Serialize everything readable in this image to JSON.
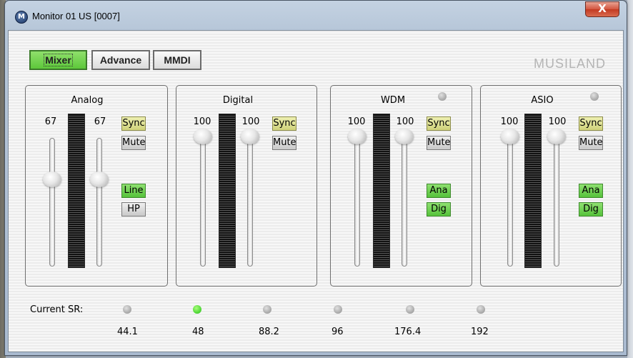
{
  "window": {
    "title": "Monitor 01 US [0007]",
    "icon_letter": "M",
    "close_glyph": "X"
  },
  "tabs": [
    {
      "label": "Mixer",
      "active": true
    },
    {
      "label": "Advance",
      "active": false
    },
    {
      "label": "MMDI",
      "active": false
    }
  ],
  "brand": "MUSILAND",
  "panels": {
    "analog": {
      "title": "Analog",
      "left_value": "67",
      "right_value": "67",
      "buttons": {
        "sync": "Sync",
        "mute": "Mute",
        "line": "Line",
        "hp": "HP"
      }
    },
    "digital": {
      "title": "Digital",
      "left_value": "100",
      "right_value": "100",
      "buttons": {
        "sync": "Sync",
        "mute": "Mute"
      }
    },
    "wdm": {
      "title": "WDM",
      "left_value": "100",
      "right_value": "100",
      "buttons": {
        "sync": "Sync",
        "mute": "Mute",
        "ana": "Ana",
        "dig": "Dig"
      }
    },
    "asio": {
      "title": "ASIO",
      "left_value": "100",
      "right_value": "100",
      "buttons": {
        "sync": "Sync",
        "mute": "Mute",
        "ana": "Ana",
        "dig": "Dig"
      }
    }
  },
  "sample_rate": {
    "label": "Current SR:",
    "rates": [
      "44.1",
      "48",
      "88.2",
      "96",
      "176.4",
      "192"
    ],
    "active": "48"
  },
  "colors": {
    "active_green": "#5dc83a",
    "sync_yellow": "#cfd27a",
    "led_on": "#1fbf12",
    "led_off": "#8c8c8c"
  }
}
